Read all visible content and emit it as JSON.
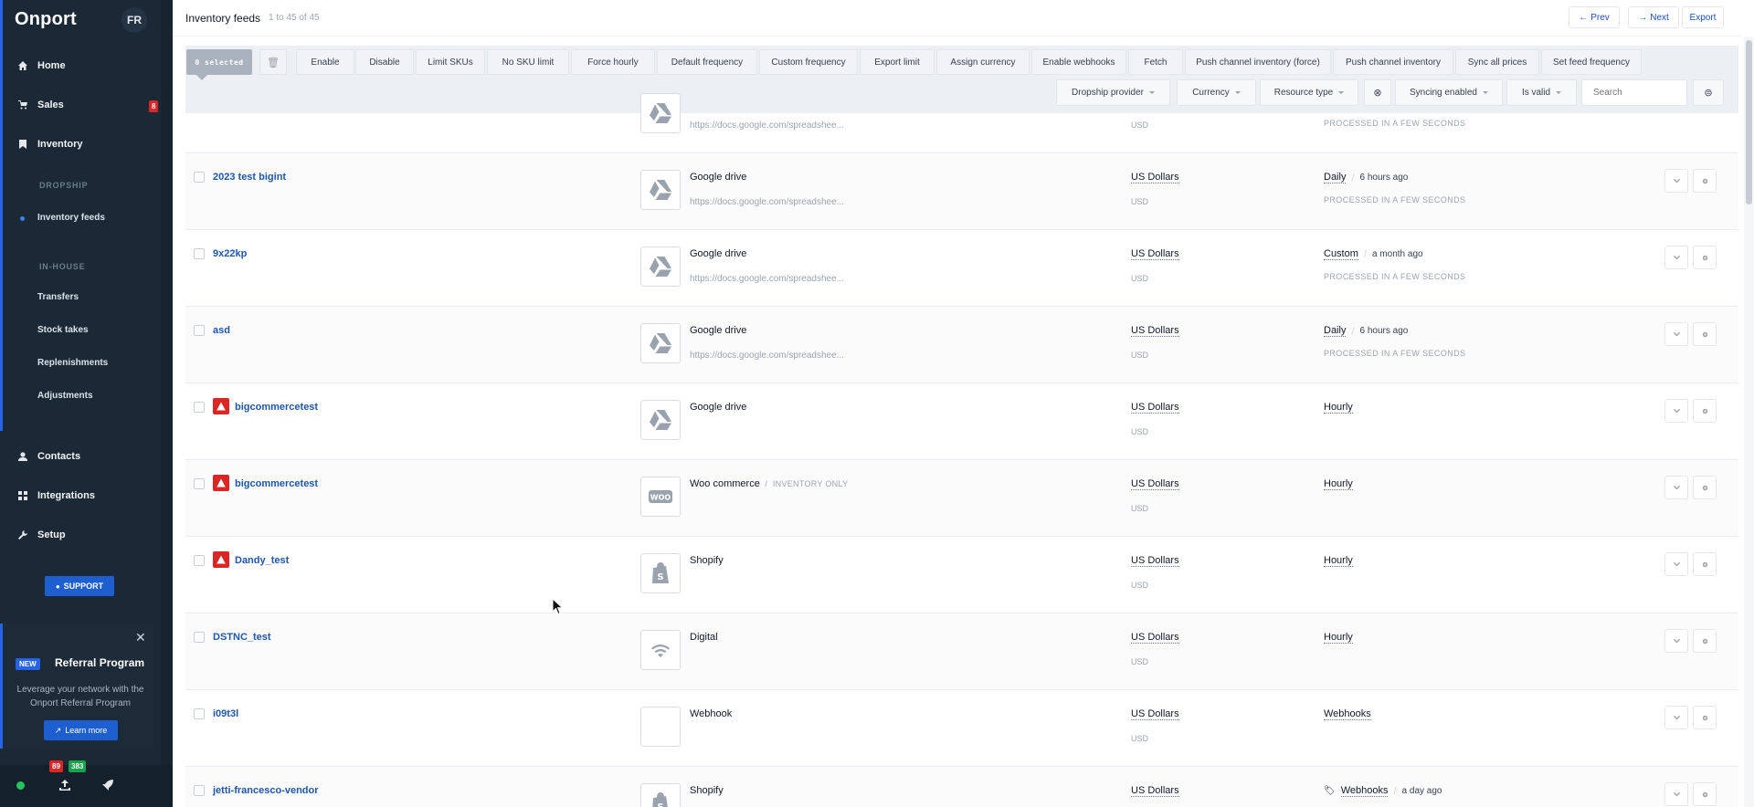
{
  "sidebar": {
    "logo": "Onport",
    "lang": "FR",
    "nav": {
      "home": "Home",
      "sales": "Sales",
      "sales_badge": "8",
      "inventory": "Inventory",
      "section_dropship": "DROPSHIP",
      "inventory_feeds": "Inventory feeds",
      "section_inhouse": "IN-HOUSE",
      "transfers": "Transfers",
      "stock_takes": "Stock takes",
      "replenishments": "Replenishments",
      "adjustments": "Adjustments",
      "contacts": "Contacts",
      "integrations": "Integrations",
      "setup": "Setup"
    },
    "support": "SUPPORT",
    "referral": {
      "new": "NEW",
      "title": "Referral Program",
      "description": "Leverage your network with the Onport Referral Program",
      "learn_more": "Learn more"
    },
    "bottom": {
      "count_red": "89",
      "count_green": "383"
    }
  },
  "header": {
    "title": "Inventory feeds",
    "count": "1 to 45 of 45",
    "prev": "Prev",
    "next": "Next",
    "export": "Export"
  },
  "toolbar": {
    "selected": "0 selected",
    "actions": [
      "Enable",
      "Disable",
      "Limit SKUs",
      "No SKU limit",
      "Force hourly",
      "Default frequency",
      "Custom frequency",
      "Export limit",
      "Assign currency",
      "Enable webhooks",
      "Fetch",
      "Push channel inventory (force)",
      "Push channel inventory",
      "Sync all prices",
      "Set feed frequency"
    ],
    "filters": {
      "dropship_provider": "Dropship provider",
      "currency": "Currency",
      "resource_type": "Resource type",
      "syncing_enabled": "Syncing enabled",
      "is_valid": "Is valid"
    },
    "search_placeholder": "Search"
  },
  "rows": [
    {
      "name": "",
      "warn": false,
      "source": "",
      "source_icon": "google-drive",
      "url": "https://docs.google.com/spreadshee...",
      "currency": "",
      "currency_code": "USD",
      "frequency": "",
      "ago": "",
      "processed": "PROCESSED IN A FEW SECONDS"
    },
    {
      "name": "2023 test bigint",
      "warn": false,
      "source": "Google drive",
      "source_icon": "google-drive",
      "url": "https://docs.google.com/spreadshee...",
      "currency": "US Dollars",
      "currency_code": "USD",
      "frequency": "Daily",
      "ago": "6 hours ago",
      "processed": "PROCESSED IN A FEW SECONDS"
    },
    {
      "name": "9x22kp",
      "warn": false,
      "source": "Google drive",
      "source_icon": "google-drive",
      "url": "https://docs.google.com/spreadshee...",
      "currency": "US Dollars",
      "currency_code": "USD",
      "frequency": "Custom",
      "ago": "a month ago",
      "processed": "PROCESSED IN A FEW SECONDS"
    },
    {
      "name": "asd",
      "warn": false,
      "source": "Google drive",
      "source_icon": "google-drive",
      "url": "https://docs.google.com/spreadshee...",
      "currency": "US Dollars",
      "currency_code": "USD",
      "frequency": "Daily",
      "ago": "6 hours ago",
      "processed": "PROCESSED IN A FEW SECONDS"
    },
    {
      "name": "bigcommercetest",
      "warn": true,
      "source": "Google drive",
      "source_icon": "google-drive",
      "url": "",
      "currency": "US Dollars",
      "currency_code": "USD",
      "frequency": "Hourly",
      "ago": "",
      "processed": ""
    },
    {
      "name": "bigcommercetest",
      "warn": true,
      "source": "Woo commerce",
      "source_tag": "INVENTORY ONLY",
      "source_icon": "woo",
      "url": "",
      "currency": "US Dollars",
      "currency_code": "USD",
      "frequency": "Hourly",
      "ago": "",
      "processed": ""
    },
    {
      "name": "Dandy_test",
      "warn": true,
      "source": "Shopify",
      "source_icon": "shopify",
      "url": "",
      "currency": "US Dollars",
      "currency_code": "USD",
      "frequency": "Hourly",
      "ago": "",
      "processed": ""
    },
    {
      "name": "DSTNC_test",
      "warn": false,
      "source": "Digital",
      "source_icon": "digital",
      "url": "",
      "currency": "US Dollars",
      "currency_code": "USD",
      "frequency": "Hourly",
      "ago": "",
      "processed": ""
    },
    {
      "name": "i09t3l",
      "warn": false,
      "source": "Webhook",
      "source_icon": "none",
      "url": "",
      "currency": "US Dollars",
      "currency_code": "USD",
      "frequency": "Webhooks",
      "ago": "",
      "processed": ""
    },
    {
      "name": "jetti-francesco-vendor",
      "warn": false,
      "source": "Shopify",
      "source_icon": "shopify",
      "url": "",
      "currency": "US Dollars",
      "currency_code": "USD",
      "frequency": "Webhooks",
      "ago": "a day ago",
      "processed": "",
      "freq_icon": "tag-icon"
    }
  ],
  "colors": {
    "accent": "#1d5fd0",
    "sidebar": "#1b2835",
    "danger": "#dc2626",
    "success": "#16a34a"
  }
}
